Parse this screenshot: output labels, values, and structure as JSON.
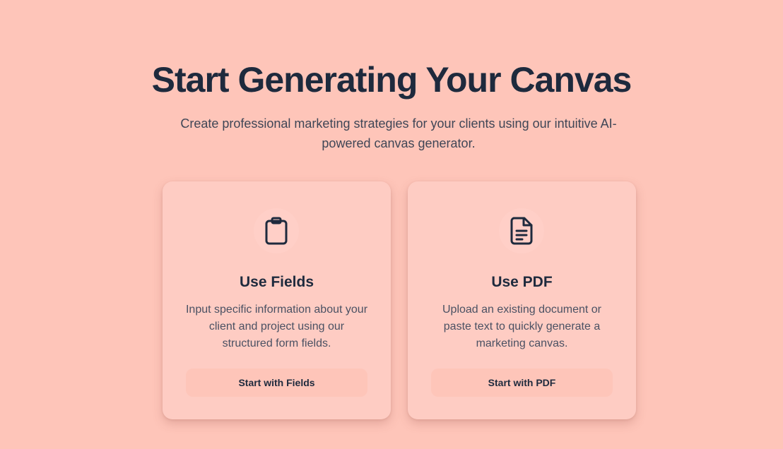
{
  "hero": {
    "title": "Start Generating Your Canvas",
    "subtitle": "Create professional marketing strategies for your clients using our intuitive AI-powered canvas generator."
  },
  "cards": [
    {
      "icon": "clipboard-icon",
      "title": "Use Fields",
      "description": "Input specific information about your client and project using our structured form fields.",
      "button_label": "Start with Fields"
    },
    {
      "icon": "document-text-icon",
      "title": "Use PDF",
      "description": "Upload an existing document or paste text to quickly generate a marketing canvas.",
      "button_label": "Start with PDF"
    }
  ],
  "colors": {
    "background": "#fec5b9",
    "card": "#feccc3",
    "button": "#fec5b9",
    "heading": "#1e2a3d"
  }
}
